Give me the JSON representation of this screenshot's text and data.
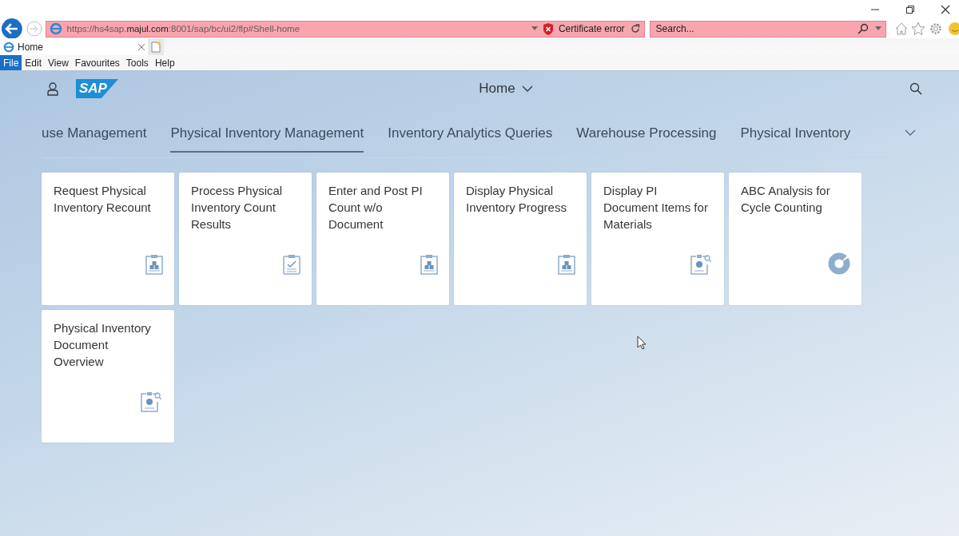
{
  "browser": {
    "address": {
      "prefix": "https://hs4sap.",
      "domain": "majul.com",
      "suffix": ":8001/sap/bc/ui2/flp#Shell-home"
    },
    "certificate": "Certificate error",
    "search": {
      "placeholder": "Search..."
    },
    "tab": {
      "title": "Home"
    },
    "menu": [
      {
        "label": "File",
        "selected": true
      },
      {
        "label": "Edit",
        "selected": false
      },
      {
        "label": "View",
        "selected": false
      },
      {
        "label": "Favourites",
        "selected": false
      },
      {
        "label": "Tools",
        "selected": false
      },
      {
        "label": "Help",
        "selected": false
      }
    ]
  },
  "shell": {
    "logo": "SAP",
    "title": "Home"
  },
  "groups": [
    {
      "label": "use Management",
      "selected": false
    },
    {
      "label": "Physical Inventory Management",
      "selected": true
    },
    {
      "label": "Inventory Analytics Queries",
      "selected": false
    },
    {
      "label": "Warehouse Processing",
      "selected": false
    },
    {
      "label": "Physical Inventory",
      "selected": false
    }
  ],
  "tiles": [
    {
      "title": "Request Physical Inventory Recount",
      "kind": "boxes"
    },
    {
      "title": "Process Physical Inventory Count Results",
      "kind": "check"
    },
    {
      "title": "Enter and Post PI Count w/o Document",
      "kind": "boxes"
    },
    {
      "title": "Display Physical Inventory Progress",
      "kind": "boxes"
    },
    {
      "title": "Display PI Document Items for Materials",
      "kind": "search"
    },
    {
      "title": "ABC Analysis for Cycle Counting",
      "kind": "donut"
    },
    {
      "title": "Physical Inventory Document Overview",
      "kind": "search"
    }
  ]
}
